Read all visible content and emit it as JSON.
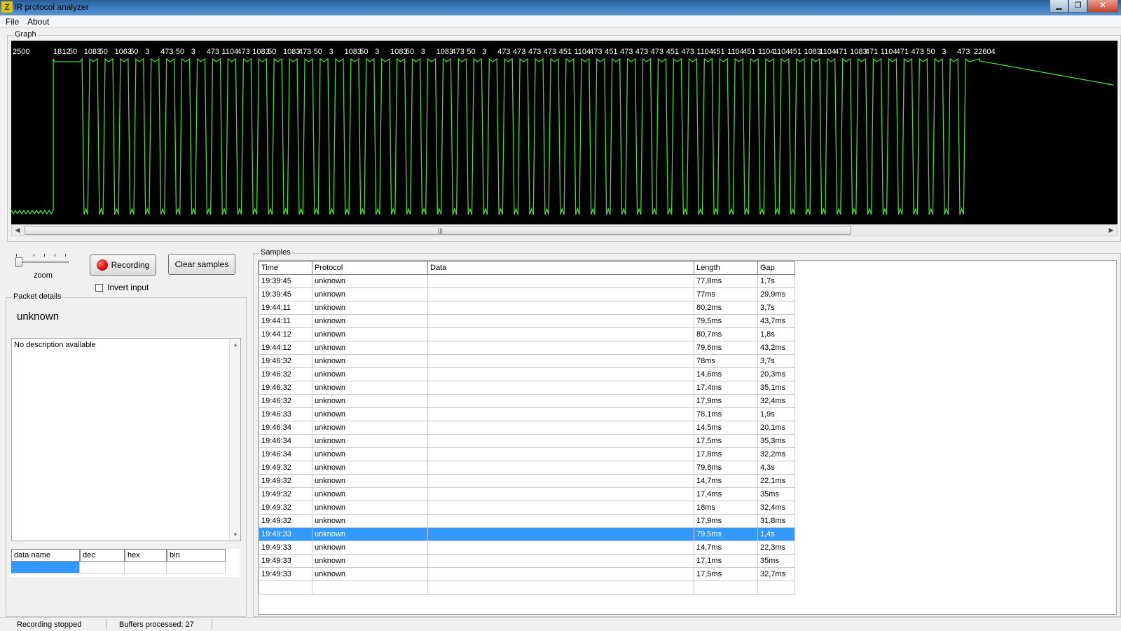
{
  "window": {
    "title": "IR protocol analyzer",
    "icon": "app-icon",
    "minimize": "▁",
    "restore": "❐",
    "close": "✕"
  },
  "menu": [
    {
      "label": "File"
    },
    {
      "label": "About"
    }
  ],
  "graph": {
    "label": "Graph",
    "bg_color": "#000000",
    "wave_color": "#44dd33",
    "text_color": "#ffffff",
    "pulse_labels": [
      "2500",
      "1812",
      "50",
      "1083",
      "50",
      "1063",
      "50",
      "3",
      "473",
      "50",
      "3",
      "473",
      "1104",
      "473",
      "1083",
      "50",
      "1083",
      "473",
      "50",
      "3",
      "1083",
      "50",
      "3",
      "1083",
      "50",
      "3",
      "1083",
      "473",
      "50",
      "3",
      "473",
      "473",
      "473",
      "473",
      "451",
      "1104",
      "473",
      "451",
      "473",
      "473",
      "473",
      "451",
      "473",
      "1104",
      "451",
      "1104",
      "451",
      "1104",
      "1104",
      "451",
      "1083",
      "1104",
      "471",
      "1083",
      "471",
      "1104",
      "471",
      "473",
      "50",
      "3",
      "473",
      "22604"
    ]
  },
  "controls": {
    "zoom_label": "zoom",
    "record_button": "Recording",
    "clear_button": "Clear samples",
    "invert_label": "Invert input"
  },
  "packet": {
    "label": "Packet details",
    "protocol_name": "unknown",
    "description": "No description available",
    "grid_headers": [
      "data name",
      "dec",
      "hex",
      "bin"
    ]
  },
  "samples": {
    "label": "Samples",
    "columns": [
      "Time",
      "Protocol",
      "Data",
      "Length",
      "Gap"
    ],
    "rows": [
      [
        "19:39:45",
        "unknown",
        "",
        "77,8ms",
        "1,7s"
      ],
      [
        "19:39:45",
        "unknown",
        "",
        "77ms",
        "29,9ms"
      ],
      [
        "19:44:11",
        "unknown",
        "",
        "80,2ms",
        "3,7s"
      ],
      [
        "19:44:11",
        "unknown",
        "",
        "79,5ms",
        "43,7ms"
      ],
      [
        "19:44:12",
        "unknown",
        "",
        "80,7ms",
        "1,8s"
      ],
      [
        "19:44:12",
        "unknown",
        "",
        "79,6ms",
        "43,2ms"
      ],
      [
        "19:46:32",
        "unknown",
        "",
        "78ms",
        "3,7s"
      ],
      [
        "19:46:32",
        "unknown",
        "",
        "14,6ms",
        "20,3ms"
      ],
      [
        "19:46:32",
        "unknown",
        "",
        "17,4ms",
        "35,1ms"
      ],
      [
        "19:46:32",
        "unknown",
        "",
        "17,9ms",
        "32,4ms"
      ],
      [
        "19:46:33",
        "unknown",
        "",
        "78,1ms",
        "1,9s"
      ],
      [
        "19:46:34",
        "unknown",
        "",
        "14,5ms",
        "20,1ms"
      ],
      [
        "19:46:34",
        "unknown",
        "",
        "17,5ms",
        "35,3ms"
      ],
      [
        "19:46:34",
        "unknown",
        "",
        "17,8ms",
        "32,2ms"
      ],
      [
        "19:49:32",
        "unknown",
        "",
        "79,8ms",
        "4,3s"
      ],
      [
        "19:49:32",
        "unknown",
        "",
        "14,7ms",
        "22,1ms"
      ],
      [
        "19:49:32",
        "unknown",
        "",
        "17,4ms",
        "35ms"
      ],
      [
        "19:49:32",
        "unknown",
        "",
        "18ms",
        "32,4ms"
      ],
      [
        "19:49:32",
        "unknown",
        "",
        "17,9ms",
        "31,8ms"
      ],
      [
        "19:49:33",
        "unknown",
        "",
        "79,5ms",
        "1,4s"
      ],
      [
        "19:49:33",
        "unknown",
        "",
        "14,7ms",
        "22,3ms"
      ],
      [
        "19:49:33",
        "unknown",
        "",
        "17,1ms",
        "35ms"
      ],
      [
        "19:49:33",
        "unknown",
        "",
        "17,5ms",
        "32,7ms"
      ],
      [
        "",
        "",
        "",
        "",
        ""
      ]
    ],
    "selected_row": 19,
    "selection_color": "#3399ff"
  },
  "status": {
    "state": "Recording stopped",
    "buffers": "Buffers processed: 27"
  }
}
